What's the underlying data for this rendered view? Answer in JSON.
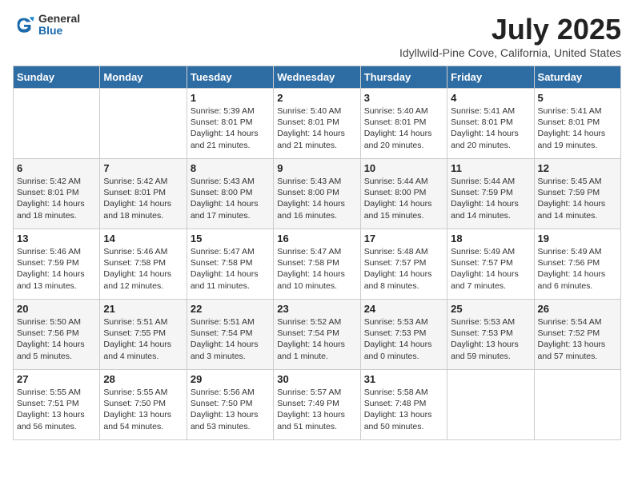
{
  "header": {
    "logo_general": "General",
    "logo_blue": "Blue",
    "month": "July 2025",
    "location": "Idyllwild-Pine Cove, California, United States"
  },
  "days_of_week": [
    "Sunday",
    "Monday",
    "Tuesday",
    "Wednesday",
    "Thursday",
    "Friday",
    "Saturday"
  ],
  "weeks": [
    [
      {
        "day": "",
        "info": ""
      },
      {
        "day": "",
        "info": ""
      },
      {
        "day": "1",
        "info": "Sunrise: 5:39 AM\nSunset: 8:01 PM\nDaylight: 14 hours and 21 minutes."
      },
      {
        "day": "2",
        "info": "Sunrise: 5:40 AM\nSunset: 8:01 PM\nDaylight: 14 hours and 21 minutes."
      },
      {
        "day": "3",
        "info": "Sunrise: 5:40 AM\nSunset: 8:01 PM\nDaylight: 14 hours and 20 minutes."
      },
      {
        "day": "4",
        "info": "Sunrise: 5:41 AM\nSunset: 8:01 PM\nDaylight: 14 hours and 20 minutes."
      },
      {
        "day": "5",
        "info": "Sunrise: 5:41 AM\nSunset: 8:01 PM\nDaylight: 14 hours and 19 minutes."
      }
    ],
    [
      {
        "day": "6",
        "info": "Sunrise: 5:42 AM\nSunset: 8:01 PM\nDaylight: 14 hours and 18 minutes."
      },
      {
        "day": "7",
        "info": "Sunrise: 5:42 AM\nSunset: 8:01 PM\nDaylight: 14 hours and 18 minutes."
      },
      {
        "day": "8",
        "info": "Sunrise: 5:43 AM\nSunset: 8:00 PM\nDaylight: 14 hours and 17 minutes."
      },
      {
        "day": "9",
        "info": "Sunrise: 5:43 AM\nSunset: 8:00 PM\nDaylight: 14 hours and 16 minutes."
      },
      {
        "day": "10",
        "info": "Sunrise: 5:44 AM\nSunset: 8:00 PM\nDaylight: 14 hours and 15 minutes."
      },
      {
        "day": "11",
        "info": "Sunrise: 5:44 AM\nSunset: 7:59 PM\nDaylight: 14 hours and 14 minutes."
      },
      {
        "day": "12",
        "info": "Sunrise: 5:45 AM\nSunset: 7:59 PM\nDaylight: 14 hours and 14 minutes."
      }
    ],
    [
      {
        "day": "13",
        "info": "Sunrise: 5:46 AM\nSunset: 7:59 PM\nDaylight: 14 hours and 13 minutes."
      },
      {
        "day": "14",
        "info": "Sunrise: 5:46 AM\nSunset: 7:58 PM\nDaylight: 14 hours and 12 minutes."
      },
      {
        "day": "15",
        "info": "Sunrise: 5:47 AM\nSunset: 7:58 PM\nDaylight: 14 hours and 11 minutes."
      },
      {
        "day": "16",
        "info": "Sunrise: 5:47 AM\nSunset: 7:58 PM\nDaylight: 14 hours and 10 minutes."
      },
      {
        "day": "17",
        "info": "Sunrise: 5:48 AM\nSunset: 7:57 PM\nDaylight: 14 hours and 8 minutes."
      },
      {
        "day": "18",
        "info": "Sunrise: 5:49 AM\nSunset: 7:57 PM\nDaylight: 14 hours and 7 minutes."
      },
      {
        "day": "19",
        "info": "Sunrise: 5:49 AM\nSunset: 7:56 PM\nDaylight: 14 hours and 6 minutes."
      }
    ],
    [
      {
        "day": "20",
        "info": "Sunrise: 5:50 AM\nSunset: 7:56 PM\nDaylight: 14 hours and 5 minutes."
      },
      {
        "day": "21",
        "info": "Sunrise: 5:51 AM\nSunset: 7:55 PM\nDaylight: 14 hours and 4 minutes."
      },
      {
        "day": "22",
        "info": "Sunrise: 5:51 AM\nSunset: 7:54 PM\nDaylight: 14 hours and 3 minutes."
      },
      {
        "day": "23",
        "info": "Sunrise: 5:52 AM\nSunset: 7:54 PM\nDaylight: 14 hours and 1 minute."
      },
      {
        "day": "24",
        "info": "Sunrise: 5:53 AM\nSunset: 7:53 PM\nDaylight: 14 hours and 0 minutes."
      },
      {
        "day": "25",
        "info": "Sunrise: 5:53 AM\nSunset: 7:53 PM\nDaylight: 13 hours and 59 minutes."
      },
      {
        "day": "26",
        "info": "Sunrise: 5:54 AM\nSunset: 7:52 PM\nDaylight: 13 hours and 57 minutes."
      }
    ],
    [
      {
        "day": "27",
        "info": "Sunrise: 5:55 AM\nSunset: 7:51 PM\nDaylight: 13 hours and 56 minutes."
      },
      {
        "day": "28",
        "info": "Sunrise: 5:55 AM\nSunset: 7:50 PM\nDaylight: 13 hours and 54 minutes."
      },
      {
        "day": "29",
        "info": "Sunrise: 5:56 AM\nSunset: 7:50 PM\nDaylight: 13 hours and 53 minutes."
      },
      {
        "day": "30",
        "info": "Sunrise: 5:57 AM\nSunset: 7:49 PM\nDaylight: 13 hours and 51 minutes."
      },
      {
        "day": "31",
        "info": "Sunrise: 5:58 AM\nSunset: 7:48 PM\nDaylight: 13 hours and 50 minutes."
      },
      {
        "day": "",
        "info": ""
      },
      {
        "day": "",
        "info": ""
      }
    ]
  ]
}
